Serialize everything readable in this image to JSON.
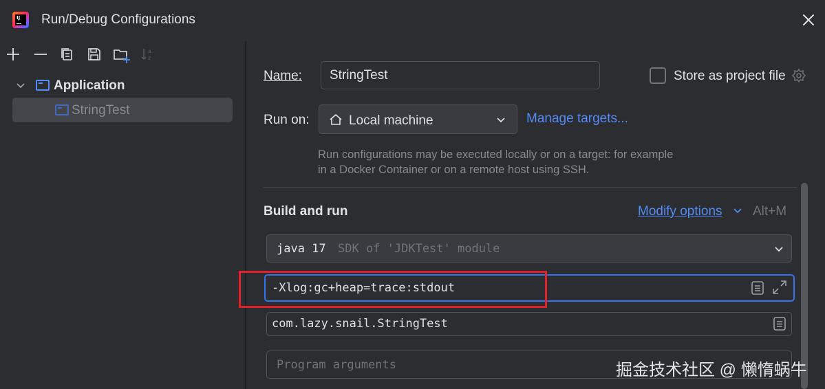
{
  "window": {
    "title": "Run/Debug Configurations",
    "app_logo_text": "IJ"
  },
  "toolbar": {
    "icons": [
      "add-icon",
      "remove-icon",
      "copy-icon",
      "save-icon",
      "new-folder-icon",
      "sort-icon"
    ]
  },
  "tree": {
    "group_label": "Application",
    "item_label": "StringTest"
  },
  "form": {
    "name_label": "Name:",
    "name_value": "StringTest",
    "store_label": "Store as project file",
    "store_checked": false,
    "run_on_label": "Run on:",
    "run_on_value": "Local machine",
    "manage_targets": "Manage targets...",
    "run_on_hint": "Run configurations may be executed locally or on a target: for example in a Docker Container or on a remote host using SSH."
  },
  "build": {
    "section_title": "Build and run",
    "modify_options": "Modify options",
    "modify_shortcut": "Alt+M",
    "sdk_main": "java 17",
    "sdk_sub": "SDK of 'JDKTest' module",
    "vm_options": "-Xlog:gc+heap=trace:stdout",
    "main_class": "com.lazy.snail.StringTest",
    "program_args_placeholder": "Program arguments"
  },
  "watermark": "掘金技术社区 @ 懒惰蜗牛",
  "colors": {
    "background": "#2b2d30",
    "accent": "#548af7",
    "focus_border": "#3574f0",
    "highlight_box": "#e0202a"
  }
}
